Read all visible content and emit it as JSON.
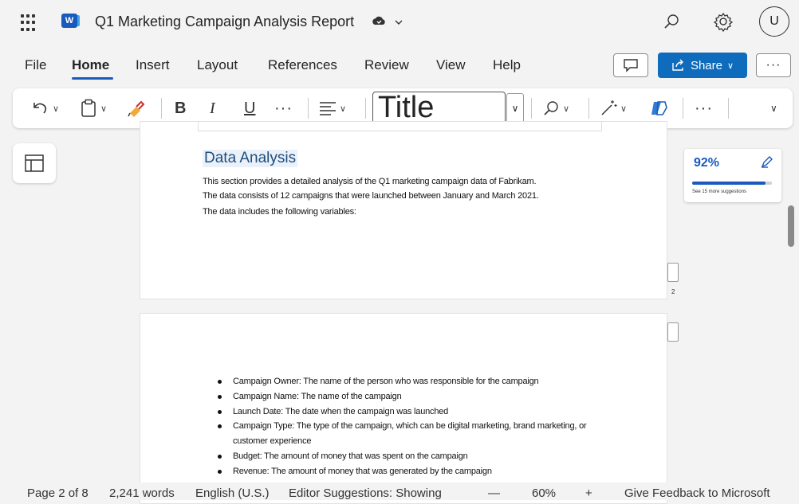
{
  "titlebar": {
    "doc_title": "Q1 Marketing Campaign Analysis Report",
    "avatar_initial": "U"
  },
  "menu": {
    "items": [
      "File",
      "Home",
      "Insert",
      "Layout",
      "References",
      "Review",
      "View",
      "Help"
    ],
    "active": "Home",
    "share_label": "Share",
    "more_label": "···"
  },
  "ribbon": {
    "bold": "B",
    "italic": "I",
    "underline": "U",
    "more": "···",
    "style_value": "Title",
    "overflow": "···"
  },
  "document": {
    "section_heading": "Data Analysis",
    "paragraph_lines": [
      "This section provides a detailed analysis of the Q1 marketing campaign data of Fabrikam.",
      "The data consists of 12 campaigns that were launched between January and March 2021.",
      "The data includes the following variables:"
    ],
    "page_number": "2",
    "bullets": [
      "Campaign Owner: The name of the person who was responsible for the campaign",
      "Campaign Name: The name of the campaign",
      "Launch Date: The date when the campaign was launched",
      "Campaign Type: The type of the campaign, which can be digital marketing, brand marketing, or customer experience",
      "Budget: The amount of money that was spent on the campaign",
      "Revenue: The amount of money that was generated by the campaign"
    ]
  },
  "editor": {
    "score": "92%",
    "score_fraction": 0.92,
    "suggestions": "See 15 more suggestions"
  },
  "status": {
    "page": "Page 2 of 8",
    "words": "2,241 words",
    "language": "English (U.S.)",
    "editor": "Editor Suggestions: Showing",
    "zoom_out": "—",
    "zoom": "60%",
    "zoom_in": "+",
    "feedback": "Give Feedback to Microsoft"
  },
  "colors": {
    "accent": "#185abd",
    "share_bg": "#0f6cbd",
    "heading": "#1f4e79"
  }
}
